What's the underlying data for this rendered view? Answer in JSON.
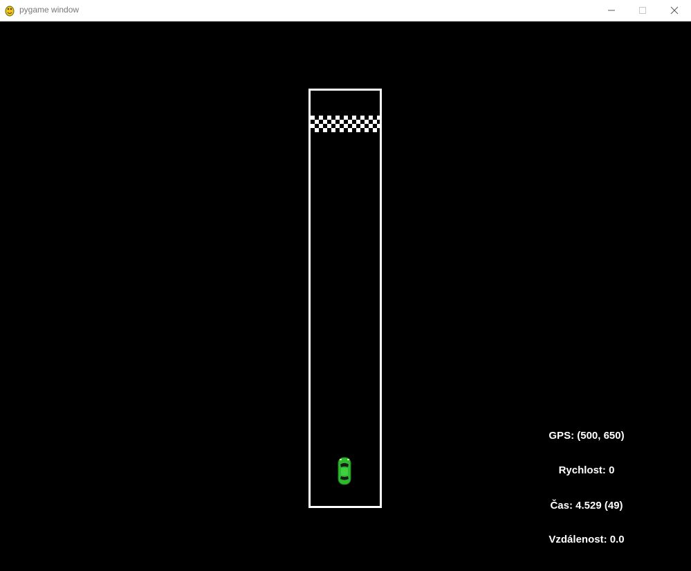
{
  "window": {
    "title": "pygame window",
    "buttons": {
      "minimize": "minimize-icon",
      "maximize": "maximize-icon",
      "close": "close-icon"
    }
  },
  "game": {
    "background_color": "#000000",
    "track_border_color": "#ffffff",
    "car_color": "#2db92d",
    "hud": {
      "gps": "GPS: (500, 650)",
      "speed": "Rychlost: 0",
      "time": "Čas: 4.529 (49)",
      "distance": "Vzdálenost: 0.0"
    }
  }
}
